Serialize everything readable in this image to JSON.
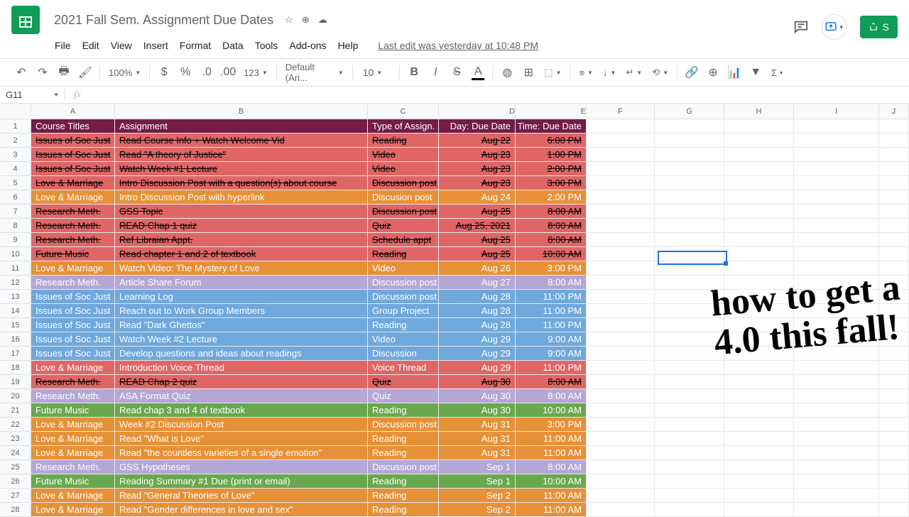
{
  "header": {
    "title": "2021 Fall Sem. Assignment Due Dates",
    "last_edit": "Last edit was yesterday at 10:48 PM",
    "share_label": "S"
  },
  "menu": [
    "File",
    "Edit",
    "View",
    "Insert",
    "Format",
    "Data",
    "Tools",
    "Add-ons",
    "Help"
  ],
  "toolbar": {
    "zoom": "100%",
    "font": "Default (Ari...",
    "font_size": "10",
    "more": "123"
  },
  "namebox": "G11",
  "columns": [
    "A",
    "B",
    "C",
    "D",
    "E",
    "F",
    "G",
    "H",
    "I",
    "J"
  ],
  "col_widths": [
    "colA",
    "colB",
    "colC",
    "colD",
    "colE",
    "colF",
    "colG",
    "colH",
    "colI",
    "colJ"
  ],
  "chart_data": {
    "type": "table",
    "headers": [
      "Course Titles",
      "Assignment",
      "Type of Assign.",
      "Day: Due Date",
      "Time: Due Date"
    ],
    "rows": [
      {
        "c": [
          "Issues of Soc Just",
          "Read Course Info + Watch Welcome Vid",
          "Reading",
          "Aug 22",
          "6:00 PM"
        ],
        "bg": "bg-red",
        "strike": true,
        "dark": true
      },
      {
        "c": [
          "Issues of Soc Just",
          "Read \"A theory of Justice\"",
          "Video",
          "Aug 23",
          "1:00 PM"
        ],
        "bg": "bg-red",
        "strike": true,
        "dark": true
      },
      {
        "c": [
          "Issues of Soc Just",
          "Watch Week #1 Lecture",
          "Video",
          "Aug 23",
          "2:00 PM"
        ],
        "bg": "bg-red",
        "strike": true,
        "dark": true
      },
      {
        "c": [
          "Love & Marriage",
          "Intro Discussion Post with a question(s) about course",
          "Discussion post",
          "Aug 23",
          "3:00 PM"
        ],
        "bg": "bg-red",
        "strike": true,
        "dark": true
      },
      {
        "c": [
          "Love & Marriage",
          "Intro Discussion Post with hyperlink",
          "Discusion post",
          "Aug 24",
          "2:00 PM"
        ],
        "bg": "bg-orange"
      },
      {
        "c": [
          "Research Meth.",
          "GSS Topic",
          "Discussion post",
          "Aug 25",
          "8:00 AM"
        ],
        "bg": "bg-red",
        "strike": true,
        "dark": true
      },
      {
        "c": [
          "Research Meth.",
          "READ Chap 1 quiz",
          "Quiz",
          "Aug 25, 2021",
          "8:00 AM"
        ],
        "bg": "bg-red",
        "strike": true,
        "dark": true
      },
      {
        "c": [
          "Research Meth.",
          "Ref Libraian Appt.",
          "Schedule appt",
          "Aug 25",
          "8:00 AM"
        ],
        "bg": "bg-red",
        "strike": true,
        "dark": true
      },
      {
        "c": [
          "Future Music",
          "Read chapter 1 and 2 of textbook",
          "Reading",
          "Aug 25",
          "10:00 AM"
        ],
        "bg": "bg-red",
        "strike": true,
        "dark": true
      },
      {
        "c": [
          "Love & Marriage",
          "Watch Video: The Mystery of Love",
          "Video",
          "Aug 26",
          "3:00 PM"
        ],
        "bg": "bg-orange"
      },
      {
        "c": [
          "Research Meth.",
          "Article Share Forum",
          "Discussion post",
          "Aug 27",
          "8:00 AM"
        ],
        "bg": "bg-purple"
      },
      {
        "c": [
          "Issues of Soc Just",
          "Learning Log",
          "Discussion post",
          "Aug 28",
          "11:00 PM"
        ],
        "bg": "bg-blue"
      },
      {
        "c": [
          "Issues of Soc Just",
          "Reach out to Work Group Members",
          "Group Project",
          "Aug 28",
          "11:00 PM"
        ],
        "bg": "bg-blue"
      },
      {
        "c": [
          "Issues of Soc Just",
          "Read \"Dark Ghettos\"",
          "Reading",
          "Aug 28",
          "11:00 PM"
        ],
        "bg": "bg-blue"
      },
      {
        "c": [
          "Issues of Soc Just",
          "Watch Week #2 Lecture",
          "Video",
          "Aug 29",
          "9:00 AM"
        ],
        "bg": "bg-blue"
      },
      {
        "c": [
          "Issues of Soc Just",
          "Develop questions and ideas about readings",
          "Discussion",
          "Aug 29",
          "9:00 AM"
        ],
        "bg": "bg-blue"
      },
      {
        "c": [
          "Love & Marriage",
          "Introduction Voice Thread",
          "Voice Thread",
          "Aug 29",
          "11:00 PM"
        ],
        "bg": "bg-red"
      },
      {
        "c": [
          "Research Meth.",
          "READ Chap 2 quiz",
          "Quiz",
          "Aug 30",
          "8:00 AM"
        ],
        "bg": "bg-red",
        "strike": true,
        "dark": true
      },
      {
        "c": [
          "Research Meth.",
          "ASA Format Quiz",
          "Quiz",
          "Aug 30",
          "8:00 AM"
        ],
        "bg": "bg-purple"
      },
      {
        "c": [
          "Future Music",
          "Read chap 3 and 4 of textbook",
          "Reading",
          "Aug 30",
          "10:00 AM"
        ],
        "bg": "bg-green"
      },
      {
        "c": [
          "Love & Marriage",
          "Week #2 Discussion Post",
          "Discussion post",
          "Aug 31",
          "3:00 PM"
        ],
        "bg": "bg-orange"
      },
      {
        "c": [
          "Love & Marriage",
          "Read \"What is Love\"",
          "Reading",
          "Aug 31",
          "11:00 AM"
        ],
        "bg": "bg-orange"
      },
      {
        "c": [
          "Love & Marriage",
          "Read \"the countless varieties of a single emotion\"",
          "Reading",
          "Aug 31",
          "11:00 AM"
        ],
        "bg": "bg-orange"
      },
      {
        "c": [
          "Research Meth.",
          "GSS Hypotheses",
          "Discussion post",
          "Sep 1",
          "8:00 AM"
        ],
        "bg": "bg-purple"
      },
      {
        "c": [
          "Future Music",
          "Reading Summary #1 Due (print or email)",
          "Reading",
          "Sep 1",
          "10:00 AM"
        ],
        "bg": "bg-green"
      },
      {
        "c": [
          "Love & Marriage",
          "Read \"General Theories of Love\"",
          "Reading",
          "Sep 2",
          "11:00 AM"
        ],
        "bg": "bg-orange"
      },
      {
        "c": [
          "Love & Marriage",
          "Read \"Gender differences in love and sex\"",
          "Reading",
          "Sep 2",
          "11:00 AM"
        ],
        "bg": "bg-orange"
      }
    ]
  },
  "overlay": "how to get a\n4.0 this fall!"
}
